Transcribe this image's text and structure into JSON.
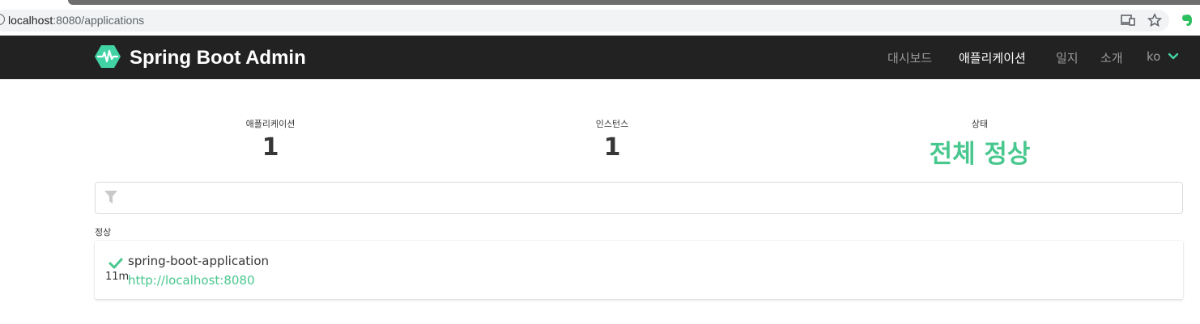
{
  "browser": {
    "url_host": "localhost",
    "url_path": ":8080/applications"
  },
  "navbar": {
    "brand": "Spring Boot Admin",
    "items": [
      {
        "label": "대시보드",
        "active": false
      },
      {
        "label": "애플리케이션",
        "active": true
      },
      {
        "label": "일지",
        "active": false
      },
      {
        "label": "소개",
        "active": false
      }
    ],
    "language": "ko"
  },
  "stats": {
    "applications_label": "애플리케이션",
    "applications_value": "1",
    "instances_label": "인스턴스",
    "instances_value": "1",
    "status_label": "상태",
    "status_value": "전체 정상"
  },
  "filter": {
    "value": "",
    "placeholder": ""
  },
  "groups": [
    {
      "label": "정상",
      "applications": [
        {
          "name": "spring-boot-application",
          "uptime": "11m",
          "url": "http://localhost:8080"
        }
      ]
    }
  ],
  "colors": {
    "navbar_bg": "#222222",
    "status_up": "#48c78e",
    "brand_icon": "#42d3a5"
  }
}
